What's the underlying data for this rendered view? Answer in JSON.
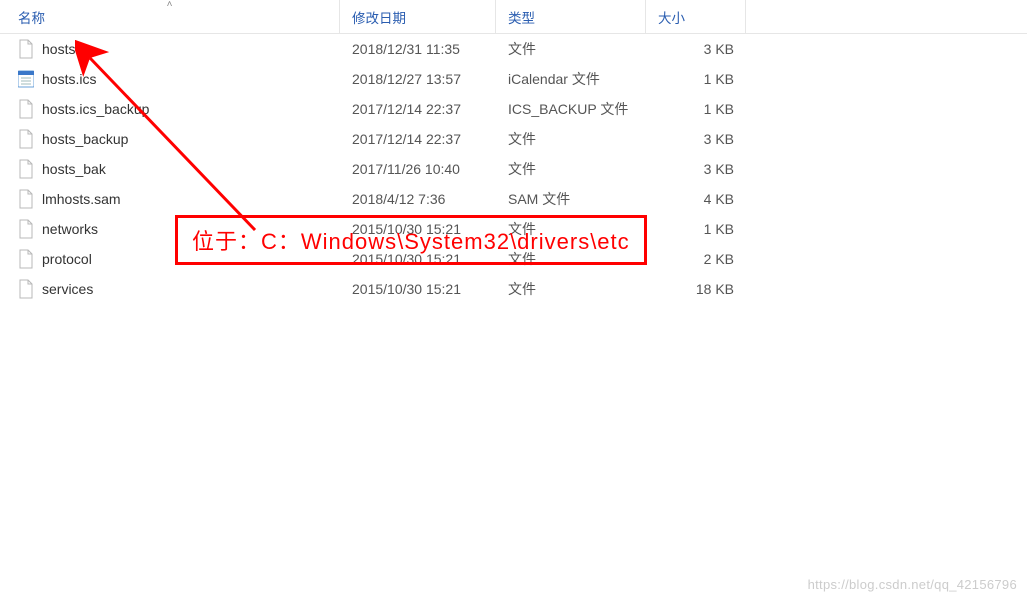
{
  "headers": {
    "name": "名称",
    "date": "修改日期",
    "type": "类型",
    "size": "大小"
  },
  "files": [
    {
      "name": "hosts",
      "date": "2018/12/31 11:35",
      "type": "文件",
      "size": "3 KB",
      "icon": "file"
    },
    {
      "name": "hosts.ics",
      "date": "2018/12/27 13:57",
      "type": "iCalendar 文件",
      "size": "1 KB",
      "icon": "calendar"
    },
    {
      "name": "hosts.ics_backup",
      "date": "2017/12/14 22:37",
      "type": "ICS_BACKUP 文件",
      "size": "1 KB",
      "icon": "file"
    },
    {
      "name": "hosts_backup",
      "date": "2017/12/14 22:37",
      "type": "文件",
      "size": "3 KB",
      "icon": "file"
    },
    {
      "name": "hosts_bak",
      "date": "2017/11/26 10:40",
      "type": "文件",
      "size": "3 KB",
      "icon": "file"
    },
    {
      "name": "lmhosts.sam",
      "date": "2018/4/12 7:36",
      "type": "SAM 文件",
      "size": "4 KB",
      "icon": "file"
    },
    {
      "name": "networks",
      "date": "2015/10/30 15:21",
      "type": "文件",
      "size": "1 KB",
      "icon": "file"
    },
    {
      "name": "protocol",
      "date": "2015/10/30 15:21",
      "type": "文件",
      "size": "2 KB",
      "icon": "file"
    },
    {
      "name": "services",
      "date": "2015/10/30 15:21",
      "type": "文件",
      "size": "18 KB",
      "icon": "file"
    }
  ],
  "annotation": "位于：C：Windows\\System32\\drivers\\etc",
  "watermark": "https://blog.csdn.net/qq_42156796"
}
